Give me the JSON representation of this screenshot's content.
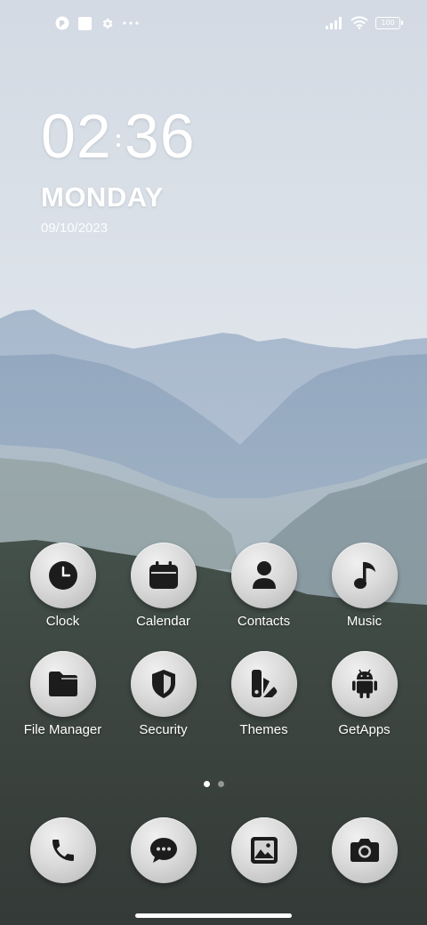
{
  "status_bar": {
    "left_icons": [
      "app-notification-icon",
      "square-notification-icon",
      "settings-gear-icon",
      "more-dots-icon"
    ],
    "right_icons": [
      "signal-bars-icon",
      "wifi-icon"
    ],
    "battery": "100"
  },
  "clock_widget": {
    "hour": "02",
    "minute": "36",
    "day": "MONDAY",
    "date": "09/10/2023"
  },
  "apps": [
    {
      "label": "Clock",
      "icon": "clock-icon"
    },
    {
      "label": "Calendar",
      "icon": "calendar-icon"
    },
    {
      "label": "Contacts",
      "icon": "contacts-icon"
    },
    {
      "label": "Music",
      "icon": "music-icon"
    },
    {
      "label": "File Manager",
      "icon": "folder-icon"
    },
    {
      "label": "Security",
      "icon": "shield-icon"
    },
    {
      "label": "Themes",
      "icon": "themes-icon"
    },
    {
      "label": "GetApps",
      "icon": "android-icon"
    }
  ],
  "page_indicator": {
    "pages": 2,
    "current": 1
  },
  "dock": [
    {
      "icon": "phone-icon"
    },
    {
      "icon": "messages-icon"
    },
    {
      "icon": "gallery-icon"
    },
    {
      "icon": "camera-icon"
    }
  ],
  "colors": {
    "icon_glyph": "#1c1c1c",
    "text": "#ffffff",
    "sky": "#dfe5ec",
    "mountains": "#9aafc6",
    "forest": "#3d4540"
  }
}
